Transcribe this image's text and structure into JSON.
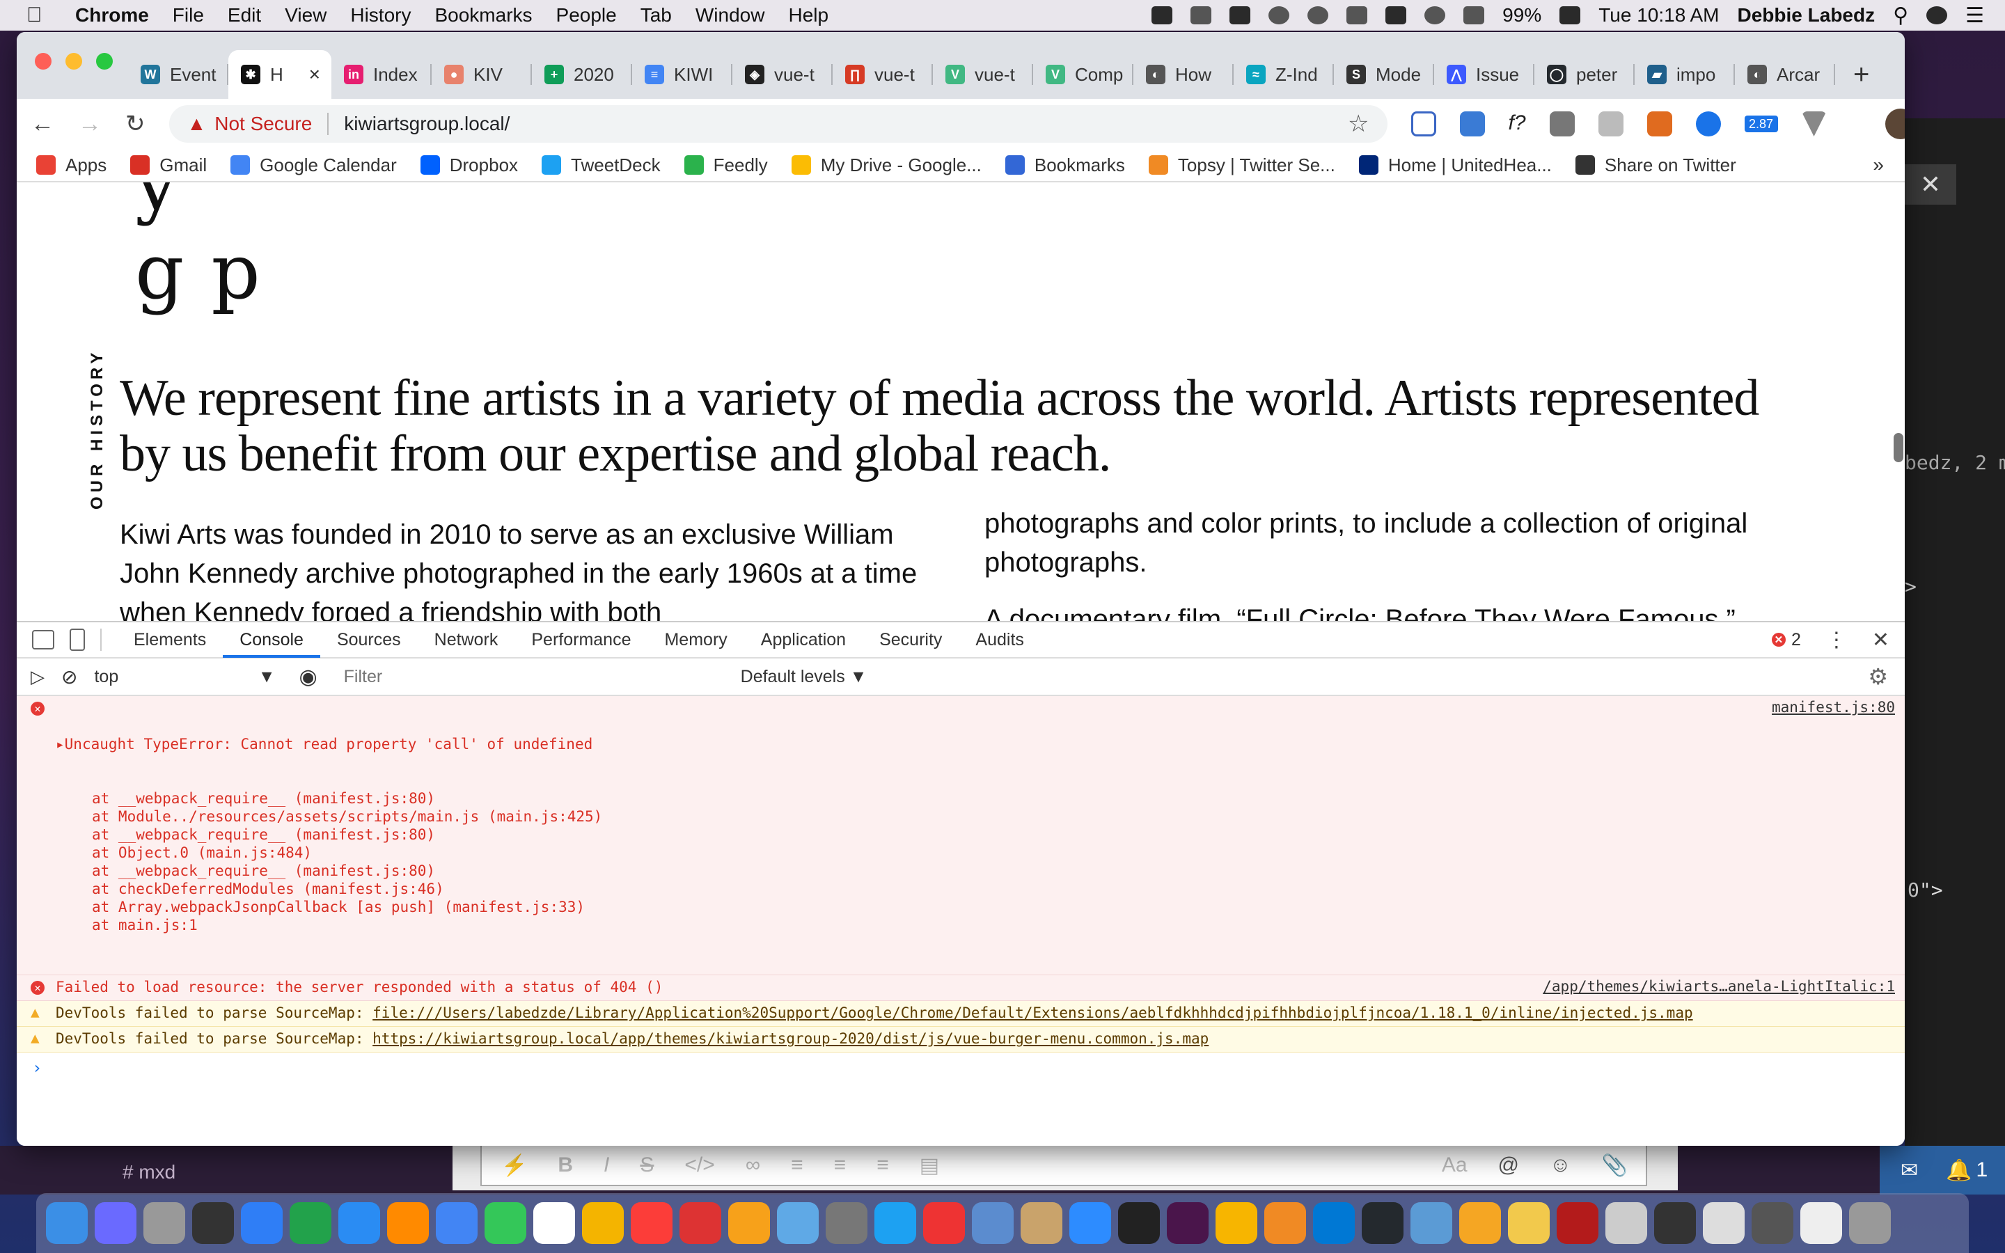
{
  "menubar": {
    "app": "Chrome",
    "menus": [
      "File",
      "Edit",
      "View",
      "History",
      "Bookmarks",
      "People",
      "Tab",
      "Window",
      "Help"
    ],
    "battery": "99%",
    "clock": "Tue 10:18 AM",
    "user": "Debbie Labedz"
  },
  "tabs": [
    {
      "label": "Event",
      "color": "#21759b",
      "glyph": "W"
    },
    {
      "label": "H",
      "color": "#111111",
      "glyph": "✱",
      "active": true
    },
    {
      "label": "Index",
      "color": "#e61e70",
      "glyph": "in"
    },
    {
      "label": "KIV",
      "color": "#e8826c",
      "glyph": "●"
    },
    {
      "label": "2020",
      "color": "#0f9d58",
      "glyph": "+"
    },
    {
      "label": "KIWI",
      "color": "#4285f4",
      "glyph": "≡"
    },
    {
      "label": "vue-t",
      "color": "#222222",
      "glyph": "◈"
    },
    {
      "label": "vue-t",
      "color": "#d63b25",
      "glyph": "∏"
    },
    {
      "label": "vue-t",
      "color": "#41b883",
      "glyph": "V"
    },
    {
      "label": "Comp",
      "color": "#41b883",
      "glyph": "V"
    },
    {
      "label": "How",
      "color": "#555555",
      "glyph": "◐"
    },
    {
      "label": "Z-Ind",
      "color": "#0aa5c0",
      "glyph": "≈"
    },
    {
      "label": "Mode",
      "color": "#333333",
      "glyph": "S"
    },
    {
      "label": "Issue",
      "color": "#3d5afe",
      "glyph": "⋀"
    },
    {
      "label": "peter",
      "color": "#24292e",
      "glyph": "◯"
    },
    {
      "label": "impo",
      "color": "#1f5f8b",
      "glyph": "▰"
    },
    {
      "label": "Arcar",
      "color": "#555555",
      "glyph": "◐"
    }
  ],
  "omnibox": {
    "warning": "Not Secure",
    "url": "kiwiartsgroup.local/"
  },
  "extensions": {
    "badge": "2.87"
  },
  "bookmarks": [
    {
      "label": "Apps",
      "color": "#e94235"
    },
    {
      "label": "Gmail",
      "color": "#d93025"
    },
    {
      "label": "Google Calendar",
      "color": "#4285f4"
    },
    {
      "label": "Dropbox",
      "color": "#0061fe"
    },
    {
      "label": "TweetDeck",
      "color": "#1da1f2"
    },
    {
      "label": "Feedly",
      "color": "#2bb24c"
    },
    {
      "label": "My Drive - Google...",
      "color": "#fbbc04"
    },
    {
      "label": "Bookmarks",
      "color": "#3367d6"
    },
    {
      "label": "Topsy | Twitter Se...",
      "color": "#f08a24"
    },
    {
      "label": "Home | UnitedHea...",
      "color": "#002677"
    },
    {
      "label": "Share on Twitter",
      "color": "#333333"
    }
  ],
  "page": {
    "side_label": "OUR HISTORY",
    "lead": "We represent fine artists in a variety of media across the world. Artists represented by us benefit from our expertise and global reach.",
    "col1": "Kiwi Arts was founded in 2010 to serve as an exclusive William John Kennedy archive photographed in the early 1960s at a time when Kennedy forged a friendship with both",
    "col2": "photographs and color prints, to include a collection of original photographs.",
    "col2b": "A documentary film, “Full Circle: Before They Were Famous,”"
  },
  "devtools": {
    "tabs": [
      "Elements",
      "Console",
      "Sources",
      "Network",
      "Performance",
      "Memory",
      "Application",
      "Security",
      "Audits"
    ],
    "active_tab": "Console",
    "error_count": "2",
    "context": "top",
    "filter_placeholder": "Filter",
    "levels": "Default levels ▼",
    "messages": {
      "err1": {
        "text": "Uncaught TypeError: Cannot read property 'call' of undefined",
        "source": "manifest.js:80",
        "stack": [
          "at __webpack_require__ (manifest.js:80)",
          "at Module../resources/assets/scripts/main.js (main.js:425)",
          "at __webpack_require__ (manifest.js:80)",
          "at Object.0 (main.js:484)",
          "at __webpack_require__ (manifest.js:80)",
          "at checkDeferredModules (manifest.js:46)",
          "at Array.webpackJsonpCallback [as push] (manifest.js:33)",
          "at main.js:1"
        ]
      },
      "err2": {
        "text": "Failed to load resource: the server responded with a status of 404 ()",
        "source": "/app/themes/kiwiarts…anela-LightItalic:1"
      },
      "warn1": {
        "prefix": "DevTools failed to parse SourceMap: ",
        "link": "file:///Users/labedzde/Library/Application%20Support/Google/Chrome/Default/Extensions/aeblfdkhhhdcdjpifhhbdiojplfjncoa/1.18.1_0/inline/injected.js.map"
      },
      "warn2": {
        "prefix": "DevTools failed to parse SourceMap: ",
        "link": "https://kiwiartsgroup.local/app/themes/kiwiartsgroup-2020/dist/js/vue-burger-menu.common.js.map"
      }
    }
  },
  "background": {
    "peek_text": "bedz, 2 m",
    "peek_code": "0\">",
    "slack_channel": "# mxd",
    "notif_count": "1"
  }
}
